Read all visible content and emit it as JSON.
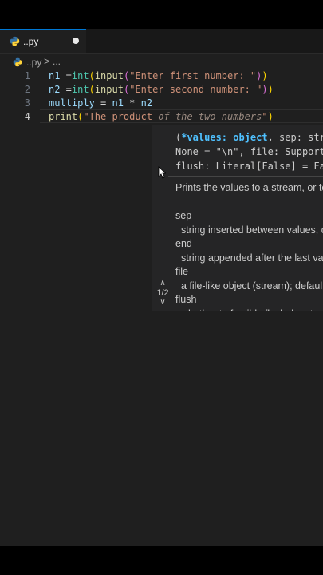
{
  "tab": {
    "filename": "..py",
    "unsaved": true
  },
  "breadcrumb": {
    "file": "..py",
    "separator": ">",
    "symbol": "..."
  },
  "lines": [
    {
      "number": "1"
    },
    {
      "number": "2"
    },
    {
      "number": "3"
    },
    {
      "number": "4",
      "active": true
    }
  ],
  "code": {
    "l1": [
      "n1",
      " =",
      "int",
      "(",
      "input",
      "(",
      "\"Enter first number: \"",
      ")",
      ")"
    ],
    "l2": [
      "n2",
      " =",
      "int",
      "(",
      "input",
      "(",
      "\"Enter second number: \"",
      ")",
      ")"
    ],
    "l3": [
      "multiply",
      " = ",
      "n1",
      " * ",
      "n2"
    ],
    "l4": [
      "print",
      "(",
      "\"The product ",
      "of the two numbers",
      "\"",
      ")"
    ]
  },
  "hover": {
    "sig_line1_a": "(",
    "sig_line1_b": "*values: object",
    "sig_line1_c": ", sep: str | None = \" \", end: str |",
    "sig_line2": "None = \"\\n\", file: SupportsWrite[str] | None = None,",
    "sig_line3": "flush: Literal[False] = False) -> None",
    "doc": "Prints the values to a stream, or to sys.stdout by default.\n\nsep\n  string inserted between values, default a space.\nend\n  string appended after the last value, default a newline.\nfile\n  a file-like object (stream); defaults to the current sys.stdout.\nflush\n  whether to forcibly flush the stream.",
    "nav_up": "∧",
    "nav_counter": "1/2",
    "nav_down": "∨"
  },
  "colors": {
    "background": "#1f1f1f",
    "accent": "#0078d4"
  },
  "icons": [
    "python-file-icon",
    "mouse-pointer-icon"
  ]
}
